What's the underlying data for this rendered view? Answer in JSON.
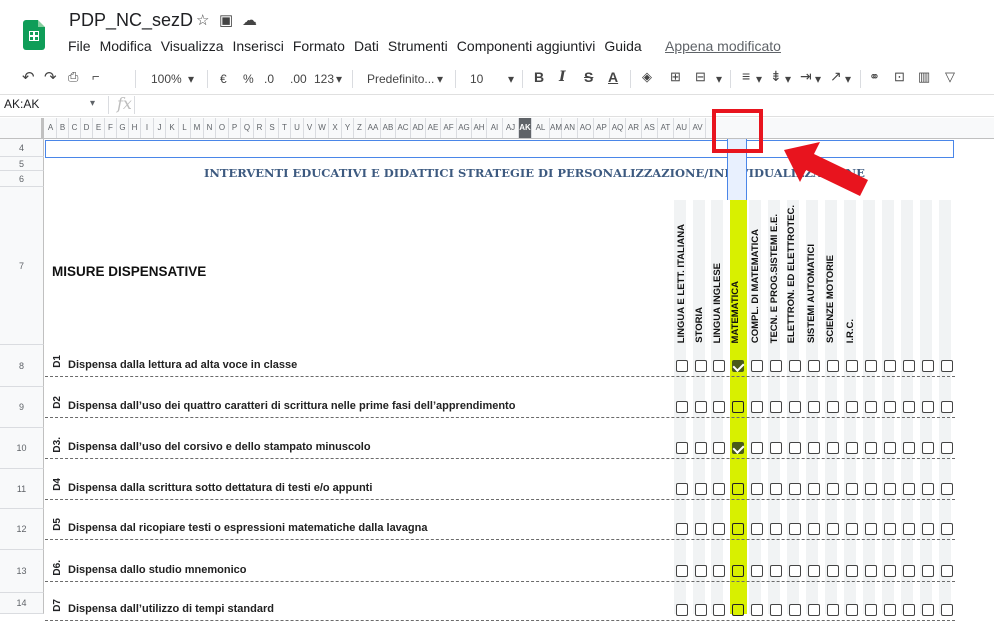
{
  "app": {
    "doc_title": "PDP_NC_sezD",
    "last_edit": "Appena modificato"
  },
  "menu": [
    "File",
    "Modifica",
    "Visualizza",
    "Inserisci",
    "Formato",
    "Dati",
    "Strumenti",
    "Componenti aggiuntivi",
    "Guida"
  ],
  "toolbar": {
    "zoom": "100%",
    "currency": "€",
    "percent": "%",
    "dec_less": ".0",
    "dec_more": ".00",
    "format_more": "123",
    "font": "Predefinito...",
    "font_size": "10",
    "bold": "B",
    "italic": "I",
    "strike": "S",
    "text_color": "A"
  },
  "formula": {
    "name_box": "AK:AK",
    "fx": "fx"
  },
  "columns": [
    "A",
    "B",
    "C",
    "D",
    "E",
    "F",
    "G",
    "H",
    "I",
    "J",
    "K",
    "L",
    "M",
    "N",
    "O",
    "P",
    "Q",
    "R",
    "S",
    "T",
    "U",
    "V",
    "W",
    "X",
    "Y",
    "Z",
    "AA",
    "AB",
    "AC",
    "AD",
    "AE",
    "AF",
    "AG",
    "AH",
    "AI",
    "AJ",
    "AK",
    "AL",
    "AM",
    "AN",
    "AO",
    "AP",
    "AQ",
    "AR",
    "AS",
    "AT",
    "AU",
    "AV"
  ],
  "selected_column": "AK",
  "rows": [
    "4",
    "5",
    "6",
    "7",
    "8",
    "9",
    "10",
    "11",
    "12",
    "13",
    "14"
  ],
  "heading": "INTERVENTI EDUCATIVI E DIDATTICI STRATEGIE DI PERSONALIZZAZIONE/INDIVIDUALIZZAZIONE",
  "section_title": "MISURE DISPENSATIVE",
  "subjects": [
    "LINGUA E LETT. ITALIANA",
    "STORIA",
    "LINGUA INGLESE",
    "MATEMATICA",
    "COMPL. DI MATEMATICA",
    "TECN. E PROG.SISTEMI E.E.",
    "ELETTRON. ED ELETTROTEC.",
    "SISTEMI AUTOMATICI",
    "SCIENZE MOTORIE",
    "I.R.C."
  ],
  "items": [
    {
      "code": "D1",
      "text": "Dispensa dalla lettura ad alta voce in classe",
      "math_checked": true
    },
    {
      "code": "D2",
      "text": "Dispensa dall’uso dei quattro caratteri di scrittura nelle prime fasi dell’apprendimento",
      "math_checked": false
    },
    {
      "code": "D3.",
      "text": "Dispensa dall’uso del corsivo e dello stampato minuscolo",
      "math_checked": true
    },
    {
      "code": "D4",
      "text": "Dispensa dalla scrittura sotto dettatura di testi e/o appunti",
      "math_checked": false
    },
    {
      "code": "D5",
      "text": "Dispensa dal ricopiare testi o espressioni matematiche dalla lavagna",
      "math_checked": false
    },
    {
      "code": "D6.",
      "text": "Dispensa dallo studio mnemonico",
      "math_checked": false
    },
    {
      "code": "D7",
      "text": "Dispensa dall’utilizzo di tempi standard",
      "math_checked": false
    }
  ],
  "colors": {
    "accent_green": "#0f9d58",
    "highlight": "#d8f000",
    "annotation_red": "#e8141e",
    "heading_blue": "#3d5a80"
  }
}
